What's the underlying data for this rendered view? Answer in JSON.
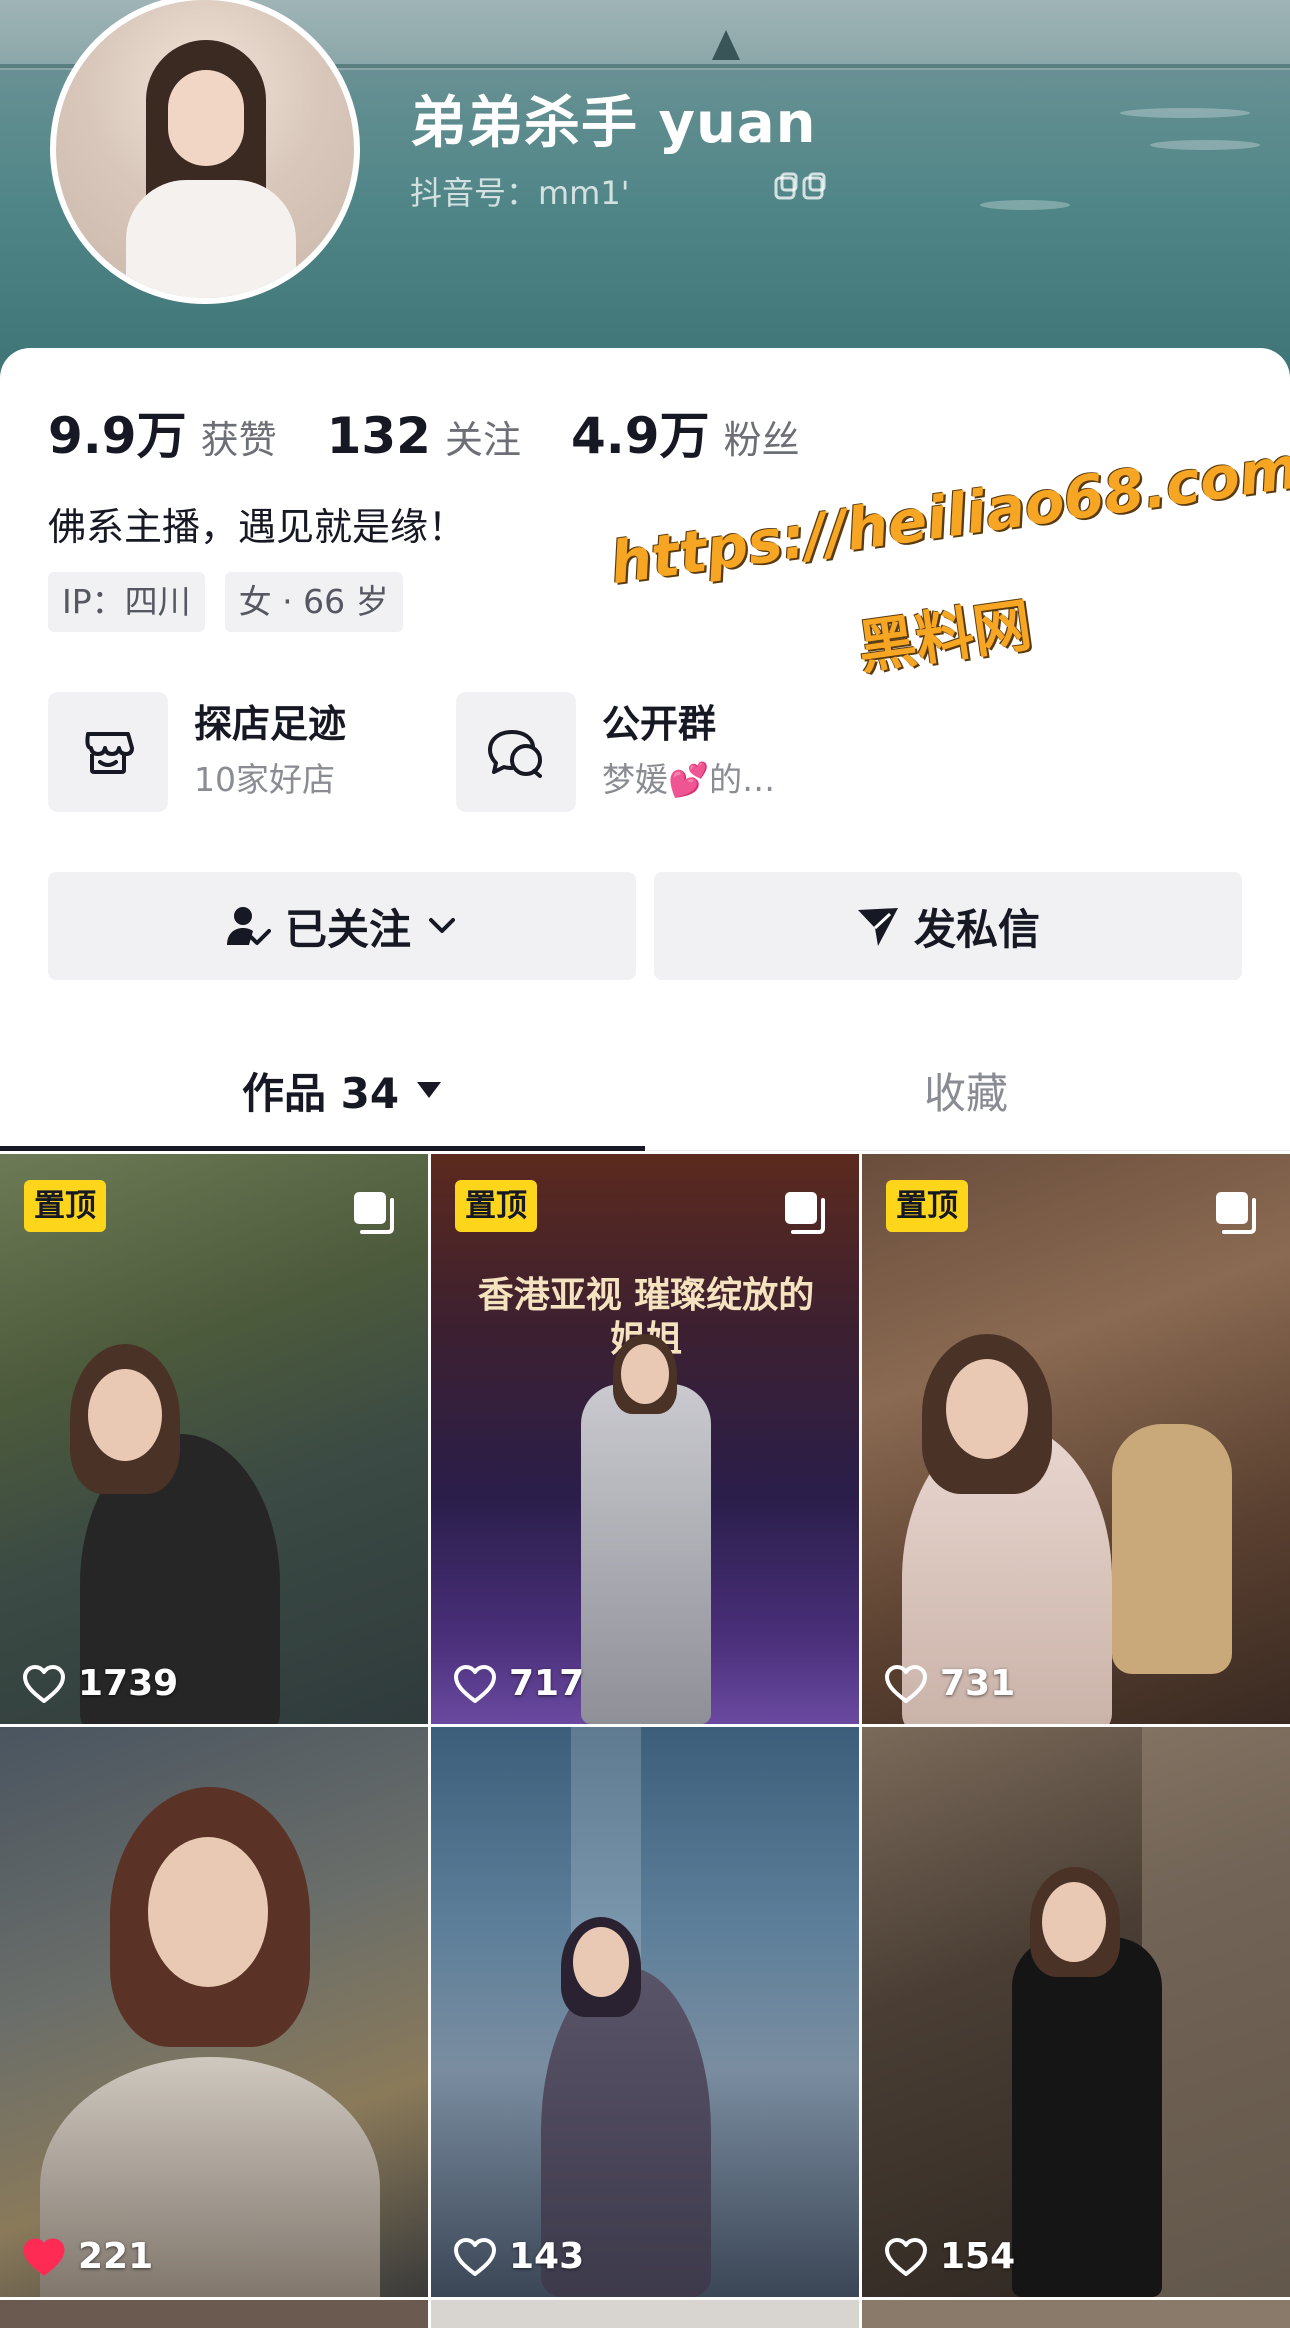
{
  "profile": {
    "name": "弟弟杀手 yuan",
    "douyin_id": "抖音号：mm1'"
  },
  "stats": [
    {
      "value": "9.9万",
      "label": "获赞"
    },
    {
      "value": "132",
      "label": "关注"
    },
    {
      "value": "4.9万",
      "label": "粉丝"
    }
  ],
  "bio": "佛系主播，遇见就是缘！",
  "tags": [
    "IP：四川",
    "女 · 66 岁"
  ],
  "features": [
    {
      "title": "探店足迹",
      "subtitle": "10家好店",
      "icon": "store-icon"
    },
    {
      "title": "公开群",
      "subtitle": "梦媛💕的…",
      "icon": "chat-group-icon"
    }
  ],
  "actions": {
    "follow_label": "已关注",
    "message_label": "发私信"
  },
  "tabs": {
    "works_label": "作品 34",
    "favorites_label": "收藏"
  },
  "videos": [
    {
      "pinned": true,
      "pin_label": "置顶",
      "likes": "1739",
      "liked": false
    },
    {
      "pinned": true,
      "pin_label": "置顶",
      "likes": "717",
      "liked": false,
      "overlay_text": "香港亚视 璀璨绽放的姐姐"
    },
    {
      "pinned": true,
      "pin_label": "置顶",
      "likes": "731",
      "liked": false
    },
    {
      "pinned": false,
      "likes": "221",
      "liked": true
    },
    {
      "pinned": false,
      "likes": "143",
      "liked": false
    },
    {
      "pinned": false,
      "likes": "154",
      "liked": false
    }
  ],
  "watermark": {
    "line1": "https://heiliao68.com",
    "line2": "黑料网"
  },
  "colors": {
    "pin_bg": "#fdd61c",
    "liked_heart": "#fe2c55",
    "text_primary": "#161823",
    "text_secondary": "#8a8c93",
    "button_bg": "#f1f1f3"
  }
}
